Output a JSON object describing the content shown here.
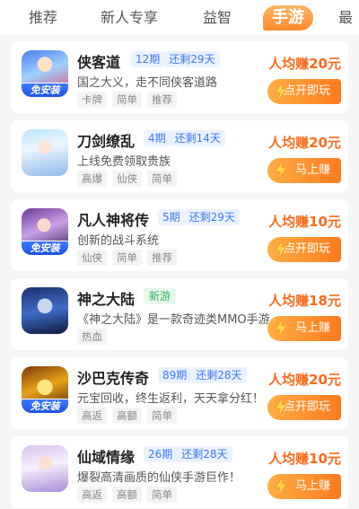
{
  "tabs": [
    {
      "label": "推荐",
      "active": false
    },
    {
      "label": "新人专享",
      "active": false
    },
    {
      "label": "益智",
      "active": false
    },
    {
      "label": "手游",
      "active": true
    },
    {
      "label": "最",
      "active": false
    }
  ],
  "games": [
    {
      "name": "侠客道",
      "period": "12期",
      "remain": "还剩29天",
      "desc": "国之大义，走不同侠客道路",
      "tags": [
        "卡牌",
        "简单",
        "推荐"
      ],
      "earn": "人均赚20元",
      "action": "点开即玩",
      "badge": "免安装",
      "icon": "warrior-hero-icon"
    },
    {
      "name": "刀剑缭乱",
      "period": "4期",
      "remain": "还剩14天",
      "desc": "上线免费领取贵族",
      "tags": [
        "高爆",
        "仙侠",
        "简单"
      ],
      "earn": "人均赚20元",
      "action": "马上赚",
      "badge": "",
      "icon": "fairy-girl-icon"
    },
    {
      "name": "凡人神将传",
      "period": "5期",
      "remain": "还剩29天",
      "desc": "创新的战斗系统",
      "tags": [
        "仙侠",
        "简单",
        "推荐"
      ],
      "earn": "人均赚10元",
      "action": "点开即玩",
      "badge": "免安装",
      "icon": "swordswoman-icon"
    },
    {
      "name": "神之大陆",
      "new_tag": "新游",
      "desc": "《神之大陆》是一款奇迹类MMO手游",
      "tags": [
        "热血"
      ],
      "earn": "人均赚18元",
      "action": "马上赚",
      "badge": "",
      "icon": "knight-armor-icon"
    },
    {
      "name": "沙巴克传奇",
      "period": "89期",
      "remain": "还剩28天",
      "desc": "元宝回收，终生返利，天天拿分红！",
      "tags": [
        "高返",
        "高额",
        "简单"
      ],
      "earn": "人均赚20元",
      "action": "点开即玩",
      "badge": "免安装",
      "icon": "gold-treasure-icon"
    },
    {
      "name": "仙域情缘",
      "period": "26期",
      "remain": "还剩28天",
      "desc": "爆裂高清画质的仙侠手游巨作！",
      "tags": [
        "高返",
        "高额",
        "简单"
      ],
      "earn": "人均赚10元",
      "action": "马上赚",
      "badge": "",
      "icon": "fairy-lady-icon"
    }
  ],
  "colors": {
    "accent": "#ff6a1a",
    "period_blue": "#3a7bff",
    "new_green": "#2fb35a"
  }
}
